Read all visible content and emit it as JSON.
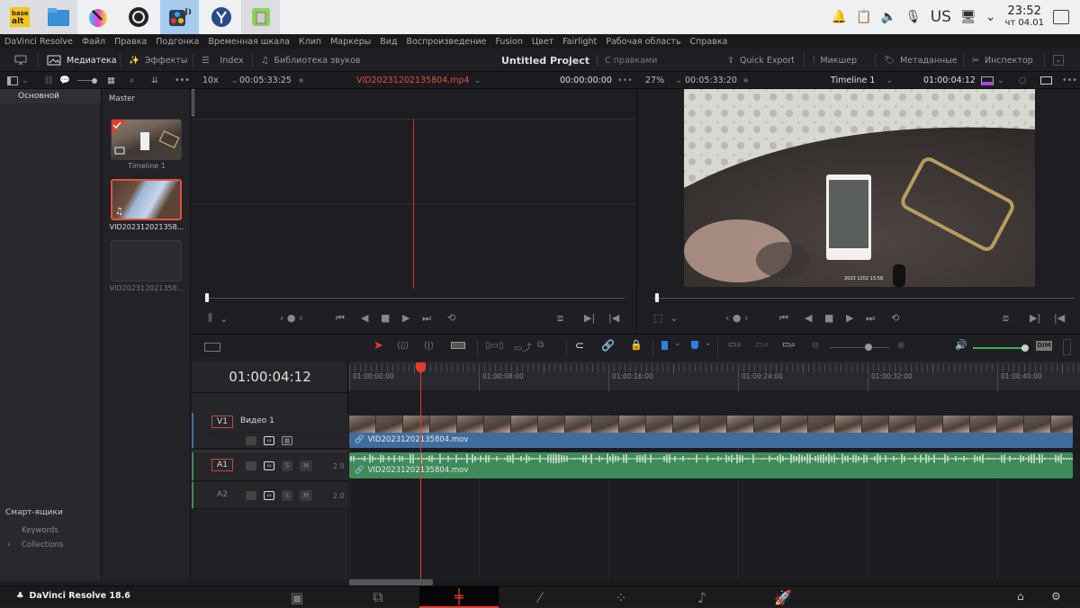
{
  "taskbar": {
    "apps": [
      {
        "name": "basealt-app",
        "label": "base alt"
      },
      {
        "name": "file-manager-app"
      },
      {
        "name": "krita-app"
      },
      {
        "name": "obs-app"
      },
      {
        "name": "davinci-resolve-app",
        "active": true
      },
      {
        "name": "yandex-browser-app"
      },
      {
        "name": "libreoffice-app"
      }
    ],
    "tray": {
      "keyboard_layout": "US",
      "time": "23:52",
      "date": "чт 04.01"
    }
  },
  "menu": [
    "DaVinci Resolve",
    "Файл",
    "Правка",
    "Подгонка",
    "Временная шкала",
    "Клип",
    "Маркеры",
    "Вид",
    "Воспроизведение",
    "Fusion",
    "Цвет",
    "Fairlight",
    "Рабочая область",
    "Справка"
  ],
  "toolbar": {
    "media_pool": "Медиатека",
    "effects": "Эффекты",
    "index": "Index",
    "sound_library": "Библиотека звуков",
    "project_title": "Untitled Project",
    "project_status": "С правками",
    "quick_export": "Quick Export",
    "mixer": "Микшер",
    "metadata": "Метаданные",
    "inspector": "Инспектор"
  },
  "source_viewer": {
    "zoom": "10x",
    "duration": "00:05:33:25",
    "clip_name": "VID20231202135804.mp4",
    "timecode": "00:00:00:00"
  },
  "program_viewer": {
    "zoom": "27%",
    "duration": "00:05:33:20",
    "timeline_name": "Timeline 1",
    "timecode": "01:00:04:12",
    "video_overlay_text": "2023 1202 13:58"
  },
  "left_panel": {
    "bins": [
      "Основной"
    ],
    "smart_bins_title": "Смарт-ящики",
    "smart_bins": [
      "Keywords",
      "Collections"
    ]
  },
  "bin": {
    "title": "Master",
    "clips": [
      {
        "name": "Timeline 1",
        "type": "timeline"
      },
      {
        "name": "VID202312021358...",
        "type": "audio-video",
        "selected": true
      },
      {
        "name": "VID202312021358...",
        "type": "empty"
      }
    ]
  },
  "timeline": {
    "timecode": "01:00:04:12",
    "ruler": [
      "01:00:00:00",
      "01:00:08:00",
      "01:00:16:00",
      "01:00:24:00",
      "01:00:32:00",
      "01:00:40:00"
    ],
    "zoom_slider": 0.65,
    "volume": 1.0,
    "dim_label": "DIM",
    "tracks": [
      {
        "id": "V1",
        "name": "Видео 1",
        "clip": "VID20231202135804.mov"
      },
      {
        "id": "A1",
        "level": "2.0",
        "clip": "VID20231202135804.mov",
        "solo": "S",
        "mute": "M"
      },
      {
        "id": "A2",
        "level": "2.0",
        "solo": "S",
        "mute": "M"
      }
    ]
  },
  "pagebar": {
    "app_name": "DaVinci Resolve 18.6",
    "pages": [
      "media",
      "cut",
      "edit",
      "fusion",
      "color",
      "fairlight",
      "deliver"
    ],
    "active_page": "edit"
  },
  "colors": {
    "accent_red": "#e53c2e",
    "video_clip": "#3f6e9e",
    "audio_clip": "#3f8b5a",
    "active_app_bg": "#a7cbee"
  }
}
